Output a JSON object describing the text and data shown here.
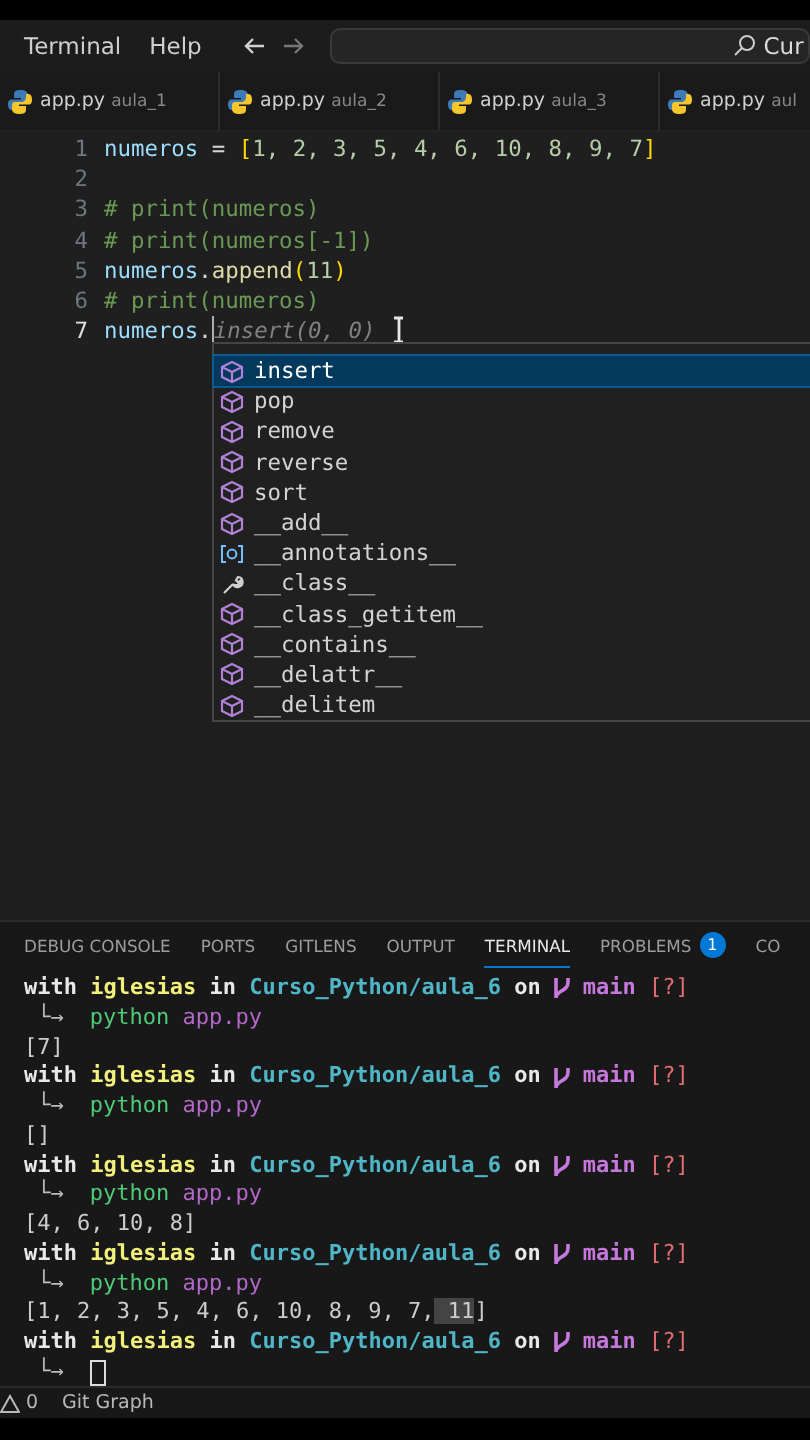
{
  "menu": {
    "items": [
      "Terminal",
      "Help"
    ],
    "search": {
      "value": "Cur"
    }
  },
  "editor_tabs": [
    {
      "file": "app.py",
      "folder": "aula_1"
    },
    {
      "file": "app.py",
      "folder": "aula_2"
    },
    {
      "file": "app.py",
      "folder": "aula_3"
    },
    {
      "file": "app.py",
      "folder": "aul"
    }
  ],
  "editor": {
    "lines": [
      {
        "number": "1",
        "active": false,
        "tokens": [
          {
            "text": "numeros",
            "kind": "name"
          },
          {
            "text": " = ",
            "kind": "op"
          },
          {
            "text": "[",
            "kind": "bracket"
          },
          {
            "text": "1, 2, 3, 5, 4, 6, 10, 8, 9, 7",
            "kind": "number"
          },
          {
            "text": "]",
            "kind": "bracket"
          }
        ]
      },
      {
        "number": "2",
        "active": false
      },
      {
        "number": "3",
        "active": false,
        "tokens": [
          {
            "text": "# print(numeros)",
            "kind": "comment"
          }
        ]
      },
      {
        "number": "4",
        "active": false,
        "tokens": [
          {
            "text": "# print(numeros[-1])",
            "kind": "comment"
          }
        ]
      },
      {
        "number": "5",
        "active": false,
        "tokens": [
          {
            "text": "numeros",
            "kind": "name"
          },
          {
            "text": ".",
            "kind": "op"
          },
          {
            "text": "append",
            "kind": "method"
          },
          {
            "text": "(",
            "kind": "bracket"
          },
          {
            "text": "11",
            "kind": "number"
          },
          {
            "text": ")",
            "kind": "bracket"
          }
        ]
      },
      {
        "number": "6",
        "active": false,
        "tokens": [
          {
            "text": "# print(numeros)",
            "kind": "comment"
          }
        ]
      },
      {
        "number": "7",
        "active": true,
        "tokens": [
          {
            "text": "numeros",
            "kind": "name"
          },
          {
            "text": ".",
            "kind": "op"
          },
          {
            "text": "insert(0, 0)",
            "kind": "ghost"
          }
        ]
      }
    ]
  },
  "suggestions": [
    {
      "label": "insert",
      "kind": "method",
      "selected": true
    },
    {
      "label": "pop",
      "kind": "method",
      "selected": false
    },
    {
      "label": "remove",
      "kind": "method",
      "selected": false
    },
    {
      "label": "reverse",
      "kind": "method",
      "selected": false
    },
    {
      "label": "sort",
      "kind": "method",
      "selected": false
    },
    {
      "label": "__add__",
      "kind": "method",
      "selected": false
    },
    {
      "label": "__annotations__",
      "kind": "variable",
      "selected": false
    },
    {
      "label": "__class__",
      "kind": "property",
      "selected": false
    },
    {
      "label": "__class_getitem__",
      "kind": "method",
      "selected": false
    },
    {
      "label": "__contains__",
      "kind": "method",
      "selected": false
    },
    {
      "label": "__delattr__",
      "kind": "method",
      "selected": false
    },
    {
      "label": "__delitem",
      "kind": "method",
      "selected": false
    }
  ],
  "panel_tabs": [
    {
      "label": "DEBUG CONSOLE",
      "selected": false
    },
    {
      "label": "PORTS",
      "selected": false
    },
    {
      "label": "GITLENS",
      "selected": false
    },
    {
      "label": "OUTPUT",
      "selected": false
    },
    {
      "label": "TERMINAL",
      "selected": true
    },
    {
      "label": "PROBLEMS",
      "selected": false,
      "badge": "1"
    },
    {
      "label": "CO",
      "selected": false
    }
  ],
  "terminal": [
    {
      "kind": "prompt",
      "parts": [
        "with",
        "iglesias",
        "in",
        "Curso_Python/aula_6",
        "on"
      ],
      "branch": "main",
      "status": "[?]"
    },
    {
      "kind": "command",
      "arrow": "└→",
      "command": "python",
      "arg": "app.py"
    },
    {
      "kind": "output",
      "segments": [
        {
          "text": "[7]",
          "selected": false
        }
      ]
    },
    {
      "kind": "prompt",
      "parts": [
        "with",
        "iglesias",
        "in",
        "Curso_Python/aula_6",
        "on"
      ],
      "branch": "main",
      "status": "[?]"
    },
    {
      "kind": "command",
      "arrow": "└→",
      "command": "python",
      "arg": "app.py"
    },
    {
      "kind": "output",
      "segments": [
        {
          "text": "[]",
          "selected": false
        }
      ]
    },
    {
      "kind": "prompt",
      "parts": [
        "with",
        "iglesias",
        "in",
        "Curso_Python/aula_6",
        "on"
      ],
      "branch": "main",
      "status": "[?]"
    },
    {
      "kind": "command",
      "arrow": "└→",
      "command": "python",
      "arg": "app.py"
    },
    {
      "kind": "output",
      "segments": [
        {
          "text": "[4, 6, 10, 8]",
          "selected": false
        }
      ]
    },
    {
      "kind": "prompt",
      "parts": [
        "with",
        "iglesias",
        "in",
        "Curso_Python/aula_6",
        "on"
      ],
      "branch": "main",
      "status": "[?]"
    },
    {
      "kind": "command",
      "arrow": "└→",
      "command": "python",
      "arg": "app.py"
    },
    {
      "kind": "output",
      "segments": [
        {
          "text": "[1, 2, 3, 5, 4, 6, 10, 8, 9, 7,",
          "selected": false
        },
        {
          "text": " 11",
          "selected": true
        },
        {
          "text": "]",
          "selected": false
        }
      ]
    },
    {
      "kind": "prompt",
      "parts": [
        "with",
        "iglesias",
        "in",
        "Curso_Python/aula_6",
        "on"
      ],
      "branch": "main",
      "status": "[?]"
    },
    {
      "kind": "command",
      "arrow": "└→",
      "cursor": true
    }
  ],
  "status_bar": {
    "warnings": "0",
    "items": [
      "Git Graph"
    ]
  }
}
